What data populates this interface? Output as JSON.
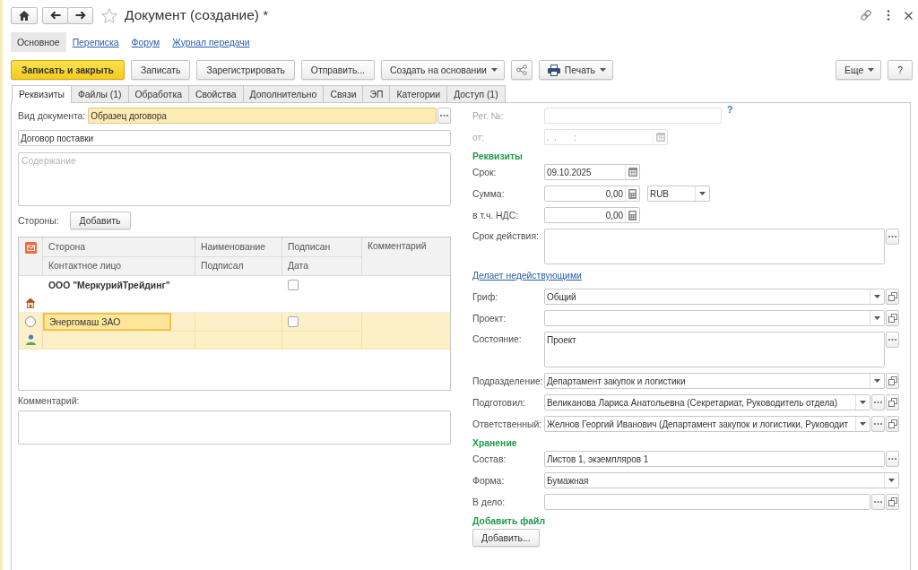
{
  "window": {
    "title": "Документ (создание) *",
    "favorite": false
  },
  "nav": [
    {
      "label": "Основное",
      "selected": true
    },
    {
      "label": "Переписка",
      "selected": false
    },
    {
      "label": "Форум",
      "selected": false
    },
    {
      "label": "Журнал передачи",
      "selected": false
    }
  ],
  "toolbar": {
    "left": [
      {
        "kind": "primary",
        "label": "Записать и закрыть"
      },
      {
        "kind": "plain",
        "label": "Записать"
      },
      {
        "kind": "plain",
        "label": "Зарегистрировать"
      },
      {
        "kind": "plain",
        "label": "Отправить..."
      },
      {
        "kind": "menu",
        "label": "Создать на основании"
      },
      {
        "kind": "share"
      },
      {
        "kind": "print",
        "label": "Печать"
      }
    ],
    "right": [
      {
        "kind": "menu",
        "label": "Еще"
      },
      {
        "kind": "plain",
        "label": "?"
      }
    ]
  },
  "tabs": [
    {
      "label": "Реквизиты",
      "selected": true
    },
    {
      "label": "Файлы (1)",
      "selected": false
    },
    {
      "label": "Обработка",
      "selected": false
    },
    {
      "label": "Свойства",
      "selected": false
    },
    {
      "label": "Дополнительно",
      "selected": false
    },
    {
      "label": "Связи",
      "selected": false
    },
    {
      "label": "ЭП",
      "selected": false
    },
    {
      "label": "Категории",
      "selected": false
    },
    {
      "label": "Доступ (1)",
      "selected": false
    }
  ],
  "main": {
    "document_type": {
      "label": "Вид документа:",
      "value": "Образец договора",
      "highlighted": true
    },
    "subject": {
      "value": "Договор поставки"
    },
    "content": {
      "placeholder": "Содержание"
    },
    "parties": {
      "label": "Стороны:",
      "add_button": "Добавить",
      "table": {
        "columns": [
          {
            "top": "Сторона",
            "bottom": "Контактное лицо"
          },
          {
            "top": "Наименование",
            "bottom": "Подписал"
          },
          {
            "top": "Подписан",
            "bottom": "Дата"
          },
          {
            "top": "Комментарий"
          }
        ],
        "rows": [
          {
            "kind": "own",
            "party": "ООО \"МеркурийТрейдинг\"",
            "signed": false,
            "selected": false
          },
          {
            "kind": "counterparty",
            "party": "Энергомаш ЗАО",
            "signed": false,
            "selected": true
          }
        ]
      }
    },
    "comment": {
      "label": "Комментарий:"
    }
  },
  "details": [
    {
      "kind": "code",
      "label": "Рег. №:",
      "disabled": true,
      "hint": "?"
    },
    {
      "kind": "datetime",
      "label": "от:",
      "value": ".  .       :",
      "disabled": true
    },
    {
      "kind": "heading",
      "text": "Реквизиты"
    },
    {
      "kind": "date",
      "label": "Срок:",
      "value": "09.10.2025",
      "disabled": false
    },
    {
      "kind": "money",
      "label": "Сумма:",
      "value": "0,00",
      "currency": "RUB",
      "disabled": false
    },
    {
      "kind": "money",
      "label": "в т.ч. НДС:",
      "value": "0,00",
      "disabled": false
    },
    {
      "kind": "memo",
      "label": "Срок действия:",
      "disabled": false
    },
    {
      "kind": "link",
      "text": "Делает недействующими"
    },
    {
      "kind": "select",
      "label": "Гриф:",
      "value": "Общий",
      "disabled": false
    },
    {
      "kind": "select",
      "label": "Проект:",
      "disabled": false
    },
    {
      "kind": "memo",
      "label": "Состояние:",
      "value": "Проект",
      "disabled": false
    },
    {
      "kind": "select",
      "label": "Подразделение:",
      "value": "Департамент закупок и логистики",
      "disabled": false
    },
    {
      "kind": "lookup",
      "label": "Подготовил:",
      "value": "Великанова Лариса Анатольевна (Секретариат, Руководитель отдела)",
      "disabled": false
    },
    {
      "kind": "lookup",
      "label": "Ответственный:",
      "value": "Желнов Георгий Иванович (Департамент закупок и логистики, Руководит",
      "disabled": false
    },
    {
      "kind": "heading",
      "text": "Хранение"
    },
    {
      "kind": "compose",
      "label": "Состав:",
      "value": "Листов 1, экземпляров 1",
      "disabled": false
    },
    {
      "kind": "choice",
      "label": "Форма:",
      "value": "Бумажная",
      "disabled": false
    },
    {
      "kind": "reference",
      "label": "В дело:",
      "disabled": false
    },
    {
      "kind": "heading",
      "text": "Добавить файл"
    },
    {
      "kind": "button",
      "text": "Добавить..."
    }
  ]
}
